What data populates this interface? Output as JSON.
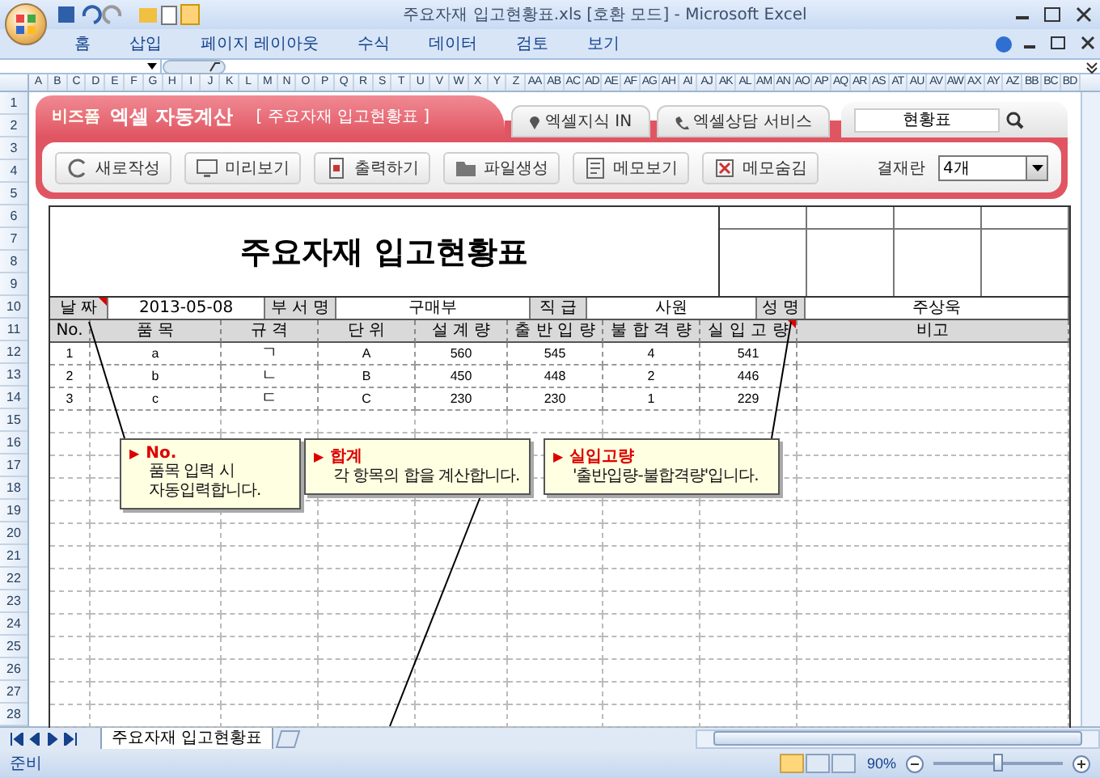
{
  "window": {
    "title": "주요자재 입고현황표.xls  [호환 모드] - Microsoft Excel"
  },
  "ribbon_tabs": [
    {
      "label": "홈",
      "selected": false
    },
    {
      "label": "삽입",
      "selected": false
    },
    {
      "label": "페이지 레이아웃",
      "selected": false
    },
    {
      "label": "수식",
      "selected": false
    },
    {
      "label": "데이터",
      "selected": false
    },
    {
      "label": "검토",
      "selected": false
    },
    {
      "label": "보기",
      "selected": false
    }
  ],
  "column_headers": [
    "A",
    "B",
    "C",
    "D",
    "E",
    "F",
    "G",
    "H",
    "I",
    "J",
    "K",
    "L",
    "M",
    "N",
    "O",
    "P",
    "Q",
    "R",
    "S",
    "T",
    "U",
    "V",
    "W",
    "X",
    "Y",
    "Z",
    "AA",
    "AB",
    "AC",
    "AD",
    "AE",
    "AF",
    "AG",
    "AH",
    "AI",
    "AJ",
    "AK",
    "AL",
    "AM",
    "AN",
    "AO",
    "AP",
    "AQ",
    "AR",
    "AS",
    "AT",
    "AU",
    "AV",
    "AW",
    "AX",
    "AY",
    "AZ",
    "BB",
    "BC",
    "BD"
  ],
  "row_headers": [
    "1",
    "2",
    "3",
    "4",
    "5",
    "6",
    "7",
    "8",
    "9",
    "10",
    "11",
    "12",
    "13",
    "14",
    "15",
    "16",
    "17",
    "18",
    "19",
    "20",
    "21",
    "22",
    "23",
    "24",
    "25",
    "26",
    "27",
    "28"
  ],
  "banner": {
    "brand": "비즈폼",
    "title": "엑셀 자동계산",
    "subtitle": "[ 주요자재 입고현황표 ]",
    "links": [
      "엑셀지식 IN",
      "엑셀상담 서비스"
    ],
    "search_value": "현황표",
    "buttons": [
      "새로작성",
      "미리보기",
      "출력하기",
      "파일생성",
      "메모보기",
      "메모숨김"
    ],
    "approval_label": "결재란",
    "approval_value": "4개"
  },
  "form": {
    "title": "주요자재 입고현황표",
    "info": [
      {
        "label": "날 짜",
        "value": "2013-05-08",
        "comment": true
      },
      {
        "label": "부 서 명",
        "value": "구매부",
        "comment": false
      },
      {
        "label": "직 급",
        "value": "사원",
        "comment": false
      },
      {
        "label": "성 명",
        "value": "주상욱",
        "comment": false
      }
    ],
    "columns": [
      {
        "label": "No.",
        "comment": false
      },
      {
        "label": "품 목",
        "comment": false
      },
      {
        "label": "규 격",
        "comment": false
      },
      {
        "label": "단 위",
        "comment": false
      },
      {
        "label": "설 계 량",
        "comment": false
      },
      {
        "label": "출 반 입 량",
        "comment": false
      },
      {
        "label": "불 합 격 량",
        "comment": false
      },
      {
        "label": "실 입 고 량",
        "comment": true
      },
      {
        "label": "비고",
        "comment": false
      }
    ],
    "rows": [
      [
        "1",
        "a",
        "ㄱ",
        "A",
        "560",
        "545",
        "4",
        "541",
        ""
      ],
      [
        "2",
        "b",
        "ㄴ",
        "B",
        "450",
        "448",
        "2",
        "446",
        ""
      ],
      [
        "3",
        "c",
        "ㄷ",
        "C",
        "230",
        "230",
        "1",
        "229",
        ""
      ]
    ],
    "callouts": [
      {
        "marker": "▶",
        "title": "No.",
        "text": "품목 입력 시\n자동입력합니다."
      },
      {
        "marker": "▶",
        "title": "합계",
        "text": "각 항목의 합을 계산합니다."
      },
      {
        "marker": "▶",
        "title": "실입고량",
        "text": "'출반입량-불합격량'입니다."
      }
    ]
  },
  "sheet_tabs": [
    {
      "label": "주요자재 입고현황표",
      "selected": true
    }
  ],
  "status_bar": {
    "status": "준비",
    "zoom": "90%",
    "zoom_slider": {
      "level": 0.5
    }
  }
}
